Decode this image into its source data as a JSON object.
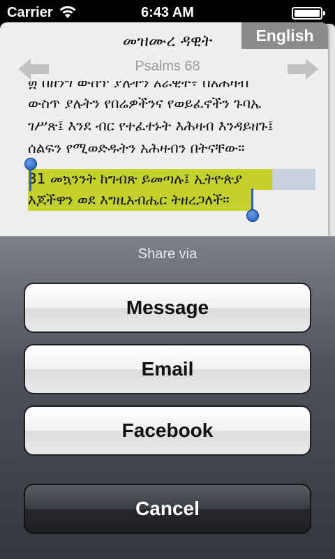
{
  "status_bar": {
    "carrier": "Carrier",
    "time": "6:43 AM"
  },
  "reader": {
    "book_title": "መዝሙረ ዳዊት",
    "chapter_ref": "Psalms 68",
    "language_button": "English",
    "verse_partial_top": "፴ በዘንግ ውስጥ ያሉትን አራዊት፥ በአሕዛብ",
    "verse_lines": [
      "ውስጥ ያሉትን የበሬዎችንና የወይፈኖችን ጉባኤ",
      "ገሥጽ፤ እንደ ብር የተፈተኑት እሕዛብ እንዳይዘጉ፤",
      "ሰልፍን የሚወድዱትን አሕዛብን በትናቸው።"
    ],
    "selected_lines": [
      "31 መኳንንት ከግብጽ ይመጣሉ፤ ኢትዮጵያ",
      "እጆችዋን ወደ እግዚአብሔር ትዘረጋለች።"
    ],
    "colors": {
      "selection_highlight": "#c4d12b",
      "selection_handle": "#1a52b8"
    }
  },
  "share_sheet": {
    "title": "Share via",
    "buttons": [
      "Message",
      "Email",
      "Facebook"
    ],
    "cancel": "Cancel"
  }
}
